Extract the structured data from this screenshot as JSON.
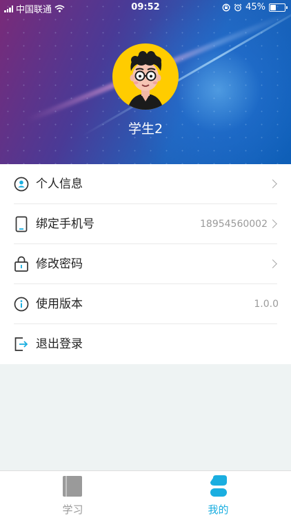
{
  "status_bar": {
    "carrier": "中国联通",
    "time": "09:52",
    "battery": "45%",
    "battery_level": 0.45,
    "icons": [
      "signal-icon",
      "wifi-icon",
      "rotation-lock-icon",
      "alarm-icon",
      "battery-icon"
    ]
  },
  "profile": {
    "username": "学生2",
    "avatar": "cartoon-boy-avatar"
  },
  "menu": {
    "items": [
      {
        "label": "个人信息",
        "value": "",
        "icon": "user-circle-icon",
        "has_arrow": true
      },
      {
        "label": "绑定手机号",
        "value": "18954560002",
        "icon": "phone-icon",
        "has_arrow": true
      },
      {
        "label": "修改密码",
        "value": "",
        "icon": "lock-icon",
        "has_arrow": true
      },
      {
        "label": "使用版本",
        "value": "1.0.0",
        "icon": "info-icon",
        "has_arrow": false
      },
      {
        "label": "退出登录",
        "value": "",
        "icon": "logout-icon",
        "has_arrow": false
      }
    ]
  },
  "tab_bar": {
    "tabs": [
      {
        "label": "学习",
        "icon": "book-icon",
        "active": false
      },
      {
        "label": "我的",
        "icon": "person-icon",
        "active": true
      }
    ]
  },
  "colors": {
    "accent": "#1aaee0",
    "inactive_tab": "#999999",
    "avatar_bg": "#ffcc00"
  }
}
